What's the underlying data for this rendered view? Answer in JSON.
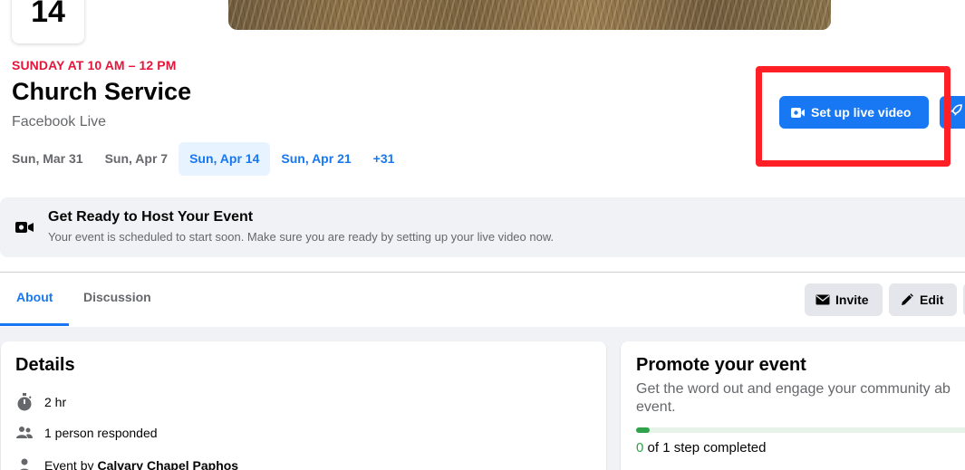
{
  "event": {
    "date_day": "14",
    "when": "SUNDAY AT 10 AM – 12 PM",
    "title": "Church Service",
    "location": "Facebook Live"
  },
  "date_tabs": [
    {
      "label": "Sun, Mar 31",
      "active": false
    },
    {
      "label": "Sun, Apr 7",
      "active": false
    },
    {
      "label": "Sun, Apr 14",
      "active": true
    },
    {
      "label": "Sun, Apr 21",
      "active": false
    },
    {
      "label": "+31",
      "active": false
    }
  ],
  "actions": {
    "live_video_label": "Set up live video",
    "live_icon": "video-camera-icon",
    "share_icon": "rocket-icon"
  },
  "notice": {
    "title": "Get Ready to Host Your Event",
    "text": "Your event is scheduled to start soon. Make sure you are ready by setting up your live video now.",
    "icon": "video-camera-icon"
  },
  "tabs": [
    {
      "label": "About",
      "active": true
    },
    {
      "label": "Discussion",
      "active": false
    }
  ],
  "toolbar": {
    "invite_label": "Invite",
    "invite_icon": "envelope-icon",
    "edit_label": "Edit",
    "edit_icon": "pencil-icon"
  },
  "details": {
    "title": "Details",
    "duration": "2 hr",
    "responded": "1 person responded",
    "host_prefix": "Event by",
    "host_name": "Calvary Chapel Paphos"
  },
  "promote": {
    "title": "Promote your event",
    "text": "Get the word out and engage your community ab event.",
    "progress_fraction": 0.04,
    "steps_done": "0",
    "steps_rest": " of 1 step completed"
  },
  "colors": {
    "accent": "#1877f2",
    "date_red": "#e4163a",
    "highlight": "#ff1f26",
    "success": "#31a24c"
  }
}
